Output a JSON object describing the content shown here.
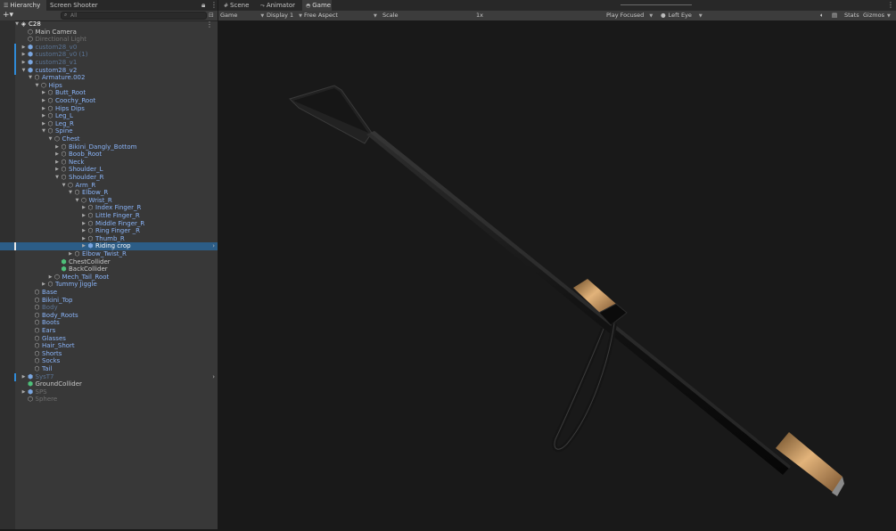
{
  "hierarchy": {
    "tabs": [
      {
        "label": "Hierarchy",
        "icon": "hierarchy-icon"
      },
      {
        "label": "Screen Shooter",
        "icon": ""
      }
    ],
    "add_label": "+▾",
    "search_placeholder": "All",
    "rows": [
      {
        "label": "C28",
        "depth": 0,
        "arrow": "down",
        "icon": "unity-logo-icon",
        "style": "white",
        "mark": ""
      },
      {
        "label": "Main Camera",
        "depth": 1,
        "arrow": "",
        "icon": "cube-icon",
        "style": "normal",
        "mark": ""
      },
      {
        "label": "Directional Light",
        "depth": 1,
        "arrow": "",
        "icon": "cube-icon",
        "style": "dim",
        "mark": ""
      },
      {
        "label": "custom28_v0",
        "depth": 1,
        "arrow": "right",
        "icon": "prefab-icon",
        "style": "dimblue",
        "mark": "blue"
      },
      {
        "label": "custom28_v0 (1)",
        "depth": 1,
        "arrow": "right",
        "icon": "prefab-icon",
        "style": "dimblue",
        "mark": "blue"
      },
      {
        "label": "custom28_v1",
        "depth": 1,
        "arrow": "right",
        "icon": "prefab-icon",
        "style": "dimblue",
        "mark": "blue"
      },
      {
        "label": "custom28_v2",
        "depth": 1,
        "arrow": "down",
        "icon": "prefab-icon",
        "style": "prefab",
        "mark": "blue"
      },
      {
        "label": "Armature.002",
        "depth": 2,
        "arrow": "down",
        "icon": "cube-icon",
        "style": "prefab",
        "mark": ""
      },
      {
        "label": "Hips",
        "depth": 3,
        "arrow": "down",
        "icon": "cube-icon",
        "style": "prefab",
        "mark": ""
      },
      {
        "label": "Butt_Root",
        "depth": 4,
        "arrow": "right",
        "icon": "cube-icon",
        "style": "prefab",
        "mark": ""
      },
      {
        "label": "Coochy_Root",
        "depth": 4,
        "arrow": "right",
        "icon": "cube-icon",
        "style": "prefab",
        "mark": ""
      },
      {
        "label": "Hips Dips",
        "depth": 4,
        "arrow": "right",
        "icon": "cube-icon",
        "style": "prefab",
        "mark": ""
      },
      {
        "label": "Leg_L",
        "depth": 4,
        "arrow": "right",
        "icon": "cube-icon",
        "style": "prefab",
        "mark": ""
      },
      {
        "label": "Leg_R",
        "depth": 4,
        "arrow": "right",
        "icon": "cube-icon",
        "style": "prefab",
        "mark": ""
      },
      {
        "label": "Spine",
        "depth": 4,
        "arrow": "down",
        "icon": "cube-icon",
        "style": "prefab",
        "mark": ""
      },
      {
        "label": "Chest",
        "depth": 5,
        "arrow": "down",
        "icon": "cube-icon",
        "style": "prefab",
        "mark": ""
      },
      {
        "label": "Bikini_Dangly_Bottom",
        "depth": 6,
        "arrow": "right",
        "icon": "cube-icon",
        "style": "prefab",
        "mark": ""
      },
      {
        "label": "Boob_Root",
        "depth": 6,
        "arrow": "right",
        "icon": "cube-icon",
        "style": "prefab",
        "mark": ""
      },
      {
        "label": "Neck",
        "depth": 6,
        "arrow": "right",
        "icon": "cube-icon",
        "style": "prefab",
        "mark": ""
      },
      {
        "label": "Shoulder_L",
        "depth": 6,
        "arrow": "right",
        "icon": "cube-icon",
        "style": "prefab",
        "mark": ""
      },
      {
        "label": "Shoulder_R",
        "depth": 6,
        "arrow": "down",
        "icon": "cube-icon",
        "style": "prefab",
        "mark": ""
      },
      {
        "label": "Arm_R",
        "depth": 7,
        "arrow": "down",
        "icon": "cube-icon",
        "style": "prefab",
        "mark": ""
      },
      {
        "label": "Elbow_R",
        "depth": 8,
        "arrow": "down",
        "icon": "cube-icon",
        "style": "prefab",
        "mark": ""
      },
      {
        "label": "Wrist_R",
        "depth": 9,
        "arrow": "down",
        "icon": "cube-icon",
        "style": "prefab",
        "mark": ""
      },
      {
        "label": "Index Finger_R",
        "depth": 10,
        "arrow": "right",
        "icon": "cube-icon",
        "style": "prefab",
        "mark": ""
      },
      {
        "label": "Little Finger_R",
        "depth": 10,
        "arrow": "right",
        "icon": "cube-icon",
        "style": "prefab",
        "mark": ""
      },
      {
        "label": "Middle Finger_R",
        "depth": 10,
        "arrow": "right",
        "icon": "cube-icon",
        "style": "prefab",
        "mark": ""
      },
      {
        "label": "Ring Finger _R",
        "depth": 10,
        "arrow": "right",
        "icon": "cube-icon",
        "style": "prefab",
        "mark": ""
      },
      {
        "label": "Thumb_R",
        "depth": 10,
        "arrow": "right",
        "icon": "cube-icon",
        "style": "prefab",
        "mark": ""
      },
      {
        "label": "Riding crop",
        "depth": 10,
        "arrow": "right",
        "icon": "prefab-icon",
        "style": "white",
        "mark": "white",
        "selected": true
      },
      {
        "label": "Elbow_Twist_R",
        "depth": 8,
        "arrow": "right",
        "icon": "cube-icon",
        "style": "prefab",
        "mark": ""
      },
      {
        "label": "ChestCollider",
        "depth": 6,
        "arrow": "",
        "icon": "collider-icon",
        "style": "normal",
        "mark": ""
      },
      {
        "label": "BackCollider",
        "depth": 6,
        "arrow": "",
        "icon": "collider-icon",
        "style": "normal",
        "mark": ""
      },
      {
        "label": "Mech_Tail_Root",
        "depth": 5,
        "arrow": "right",
        "icon": "cube-icon",
        "style": "prefab",
        "mark": ""
      },
      {
        "label": "Tummy Jiggle",
        "depth": 4,
        "arrow": "right",
        "icon": "cube-icon",
        "style": "prefab",
        "mark": ""
      },
      {
        "label": "Base",
        "depth": 2,
        "arrow": "",
        "icon": "cube-icon",
        "style": "prefab",
        "mark": ""
      },
      {
        "label": "Bikini_Top",
        "depth": 2,
        "arrow": "",
        "icon": "cube-icon",
        "style": "prefab",
        "mark": ""
      },
      {
        "label": "Body",
        "depth": 2,
        "arrow": "",
        "icon": "cube-icon",
        "style": "dimblue",
        "mark": ""
      },
      {
        "label": "Body_Roots",
        "depth": 2,
        "arrow": "",
        "icon": "cube-icon",
        "style": "prefab",
        "mark": ""
      },
      {
        "label": "Boots",
        "depth": 2,
        "arrow": "",
        "icon": "cube-icon",
        "style": "prefab",
        "mark": ""
      },
      {
        "label": "Ears",
        "depth": 2,
        "arrow": "",
        "icon": "cube-icon",
        "style": "prefab",
        "mark": ""
      },
      {
        "label": "Glasses",
        "depth": 2,
        "arrow": "",
        "icon": "cube-icon",
        "style": "prefab",
        "mark": ""
      },
      {
        "label": "Hair_Short",
        "depth": 2,
        "arrow": "",
        "icon": "cube-icon",
        "style": "prefab",
        "mark": ""
      },
      {
        "label": "Shorts",
        "depth": 2,
        "arrow": "",
        "icon": "cube-icon",
        "style": "prefab",
        "mark": ""
      },
      {
        "label": "Socks",
        "depth": 2,
        "arrow": "",
        "icon": "cube-icon",
        "style": "prefab",
        "mark": ""
      },
      {
        "label": "Tail",
        "depth": 2,
        "arrow": "",
        "icon": "cube-icon",
        "style": "prefab",
        "mark": ""
      },
      {
        "label": "SysT7",
        "depth": 1,
        "arrow": "right",
        "icon": "prefab-icon",
        "style": "dimblue",
        "mark": "blue",
        "chevron": true
      },
      {
        "label": "GroundCollider",
        "depth": 1,
        "arrow": "",
        "icon": "collider-icon",
        "style": "normal",
        "mark": ""
      },
      {
        "label": "SPS",
        "depth": 1,
        "arrow": "right",
        "icon": "prefab-icon",
        "style": "dim",
        "mark": ""
      },
      {
        "label": "Sphere",
        "depth": 1,
        "arrow": "",
        "icon": "cube-icon",
        "style": "dim",
        "mark": ""
      }
    ]
  },
  "game": {
    "tabs": [
      {
        "label": "Scene",
        "icon": "scene-icon"
      },
      {
        "label": "Animator",
        "icon": "animator-icon"
      },
      {
        "label": "Game",
        "icon": "gamepad-icon"
      }
    ],
    "toolbar": {
      "mode": "Game",
      "display": "Display 1",
      "aspect": "Free Aspect",
      "scale_label": "Scale",
      "scale_value": "1x",
      "play_mode": "Play Focused",
      "eye": "Left Eye",
      "stats": "Stats",
      "gizmos": "Gizmos"
    }
  },
  "colors": {
    "panel": "#383838",
    "selection": "#2c5d87",
    "prefab_text": "#8ab4f8",
    "viewport": "#191919",
    "crop_gold": "#c8965a"
  }
}
